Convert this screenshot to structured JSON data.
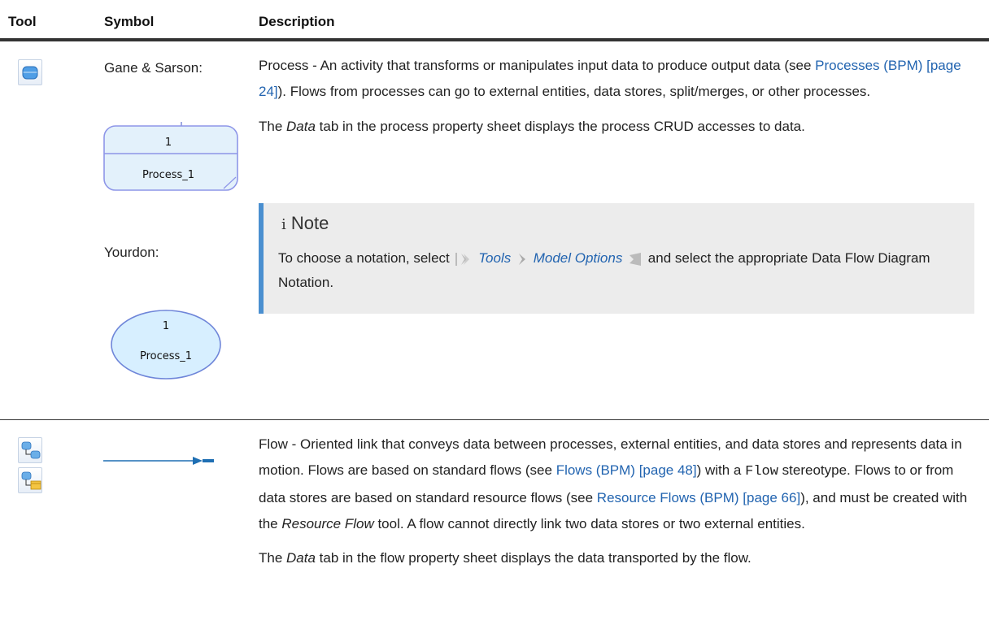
{
  "table": {
    "headers": {
      "tool": "Tool",
      "symbol": "Symbol",
      "description": "Description"
    }
  },
  "row1": {
    "symbol_gs_label": "Gane & Sarson:",
    "symbol_yourdon_label": "Yourdon:",
    "gs_shape": {
      "number": "1",
      "name": "Process_1"
    },
    "yourdon_shape": {
      "number": "1",
      "name": "Process_1"
    },
    "desc_p1": {
      "text_a": "Process - An activity that transforms or manipulates input data to produce output data (see ",
      "link": "Processes (BPM) [page 24]",
      "text_b": "). Flows from processes can go to external entities, data stores, split/merges, or other processes."
    },
    "desc_p2": {
      "text_a": "The ",
      "em": "Data",
      "text_b": " tab in the process property sheet displays the process CRUD accesses to data."
    },
    "note": {
      "icon": "i",
      "title": "Note",
      "text_a": "To choose a notation, select ",
      "menu1": "Tools",
      "menu2": "Model Options",
      "text_b": " and select the appropriate Data Flow Diagram Notation."
    }
  },
  "row2": {
    "desc_p1": {
      "text_a": "Flow - Oriented link that conveys data between processes, external entities, and data stores and represents data in motion. Flows are based on standard flows (see ",
      "link1": "Flows (BPM) [page 48]",
      "text_b": ") with a ",
      "code": "Flow",
      "text_c": " stereotype. Flows to or from data stores are based on standard resource flows (see ",
      "link2": "Resource Flows (BPM) [page 66]",
      "text_d": "), and must be created with the ",
      "em": "Resource Flow",
      "text_e": " tool. A flow cannot directly link two data stores or two external entities."
    },
    "desc_p2": {
      "text_a": "The ",
      "em": "Data",
      "text_b": " tab in the flow property sheet displays the data transported by the flow."
    }
  },
  "colors": {
    "link": "#2264b0",
    "note_bar": "#4a8fd0",
    "note_bg": "#ececec",
    "process_fill": "#e3f1fb",
    "yourdon_fill": "#d7efff",
    "flow_line": "#1f6fb3"
  },
  "icons": [
    "process-tool-icon",
    "flow-tool-icon",
    "resource-flow-tool-icon",
    "note-info-icon",
    "menu-arrow-icon"
  ]
}
